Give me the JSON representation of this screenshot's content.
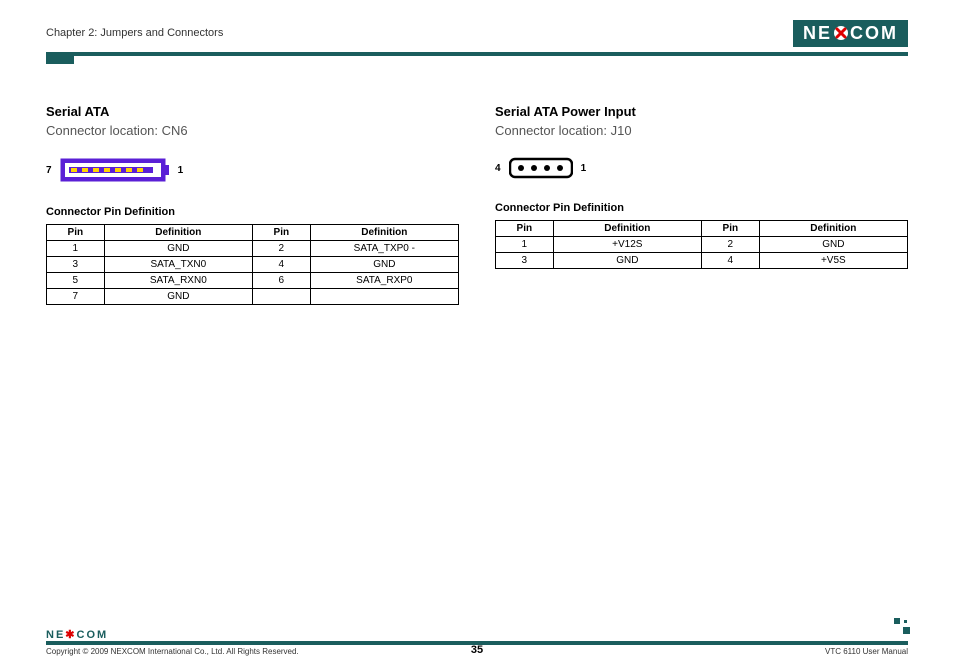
{
  "header": {
    "chapter": "Chapter 2: Jumpers and Connectors",
    "logo_text": "NE COM",
    "logo_x": "X"
  },
  "left": {
    "title": "Serial ATA",
    "location": "Connector location: CN6",
    "pin_left": "7",
    "pin_right": "1",
    "table_title": "Connector Pin Definition",
    "headers": {
      "pin": "Pin",
      "def": "Definition"
    },
    "rows": [
      {
        "p1": "1",
        "d1": "GND",
        "p2": "2",
        "d2": "SATA_TXP0 -"
      },
      {
        "p1": "3",
        "d1": "SATA_TXN0",
        "p2": "4",
        "d2": "GND"
      },
      {
        "p1": "5",
        "d1": "SATA_RXN0",
        "p2": "6",
        "d2": "SATA_RXP0"
      },
      {
        "p1": "7",
        "d1": "GND",
        "p2": "",
        "d2": ""
      }
    ]
  },
  "right": {
    "title": "Serial ATA Power Input",
    "location": "Connector location: J10",
    "pin_left": "4",
    "pin_right": "1",
    "table_title": "Connector Pin Definition",
    "headers": {
      "pin": "Pin",
      "def": "Definition"
    },
    "rows": [
      {
        "p1": "1",
        "d1": "+V12S",
        "p2": "2",
        "d2": "GND"
      },
      {
        "p1": "3",
        "d1": "GND",
        "p2": "4",
        "d2": "+V5S"
      }
    ]
  },
  "footer": {
    "logo": "NE COM",
    "logo_x": "X",
    "copyright": "Copyright © 2009 NEXCOM International Co., Ltd. All Rights Reserved.",
    "page": "35",
    "manual": "VTC 6110 User Manual"
  }
}
